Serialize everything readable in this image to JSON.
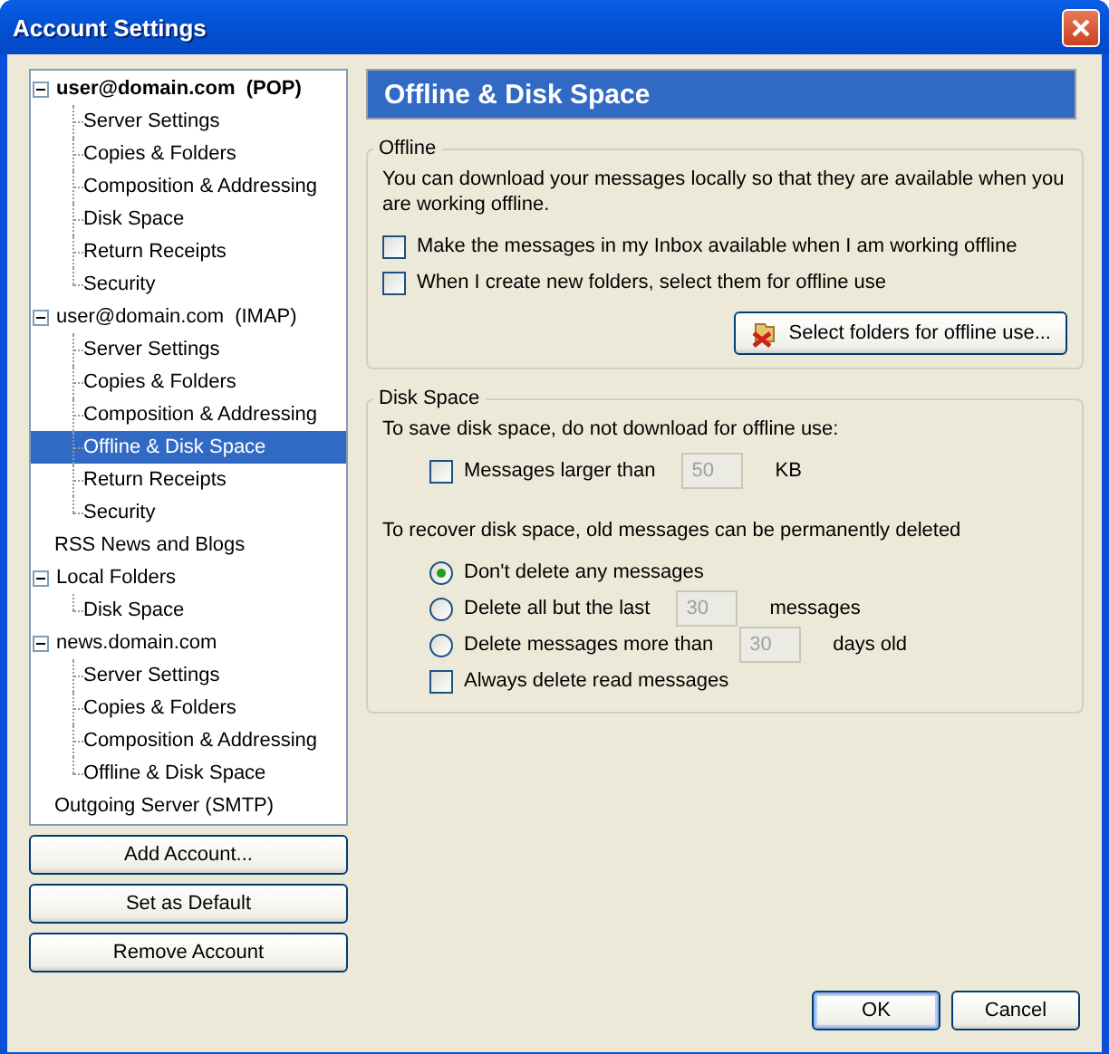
{
  "window": {
    "title": "Account Settings"
  },
  "tree": [
    {
      "label": "user@domain.com  (POP)",
      "is_default": true,
      "expanded": true,
      "selected": false,
      "children": [
        {
          "label": "Server Settings",
          "selected": false
        },
        {
          "label": "Copies & Folders",
          "selected": false
        },
        {
          "label": "Composition & Addressing",
          "selected": false
        },
        {
          "label": "Disk Space",
          "selected": false
        },
        {
          "label": "Return Receipts",
          "selected": false
        },
        {
          "label": "Security",
          "selected": false
        }
      ]
    },
    {
      "label": "user@domain.com  (IMAP)",
      "is_default": false,
      "expanded": true,
      "selected": false,
      "children": [
        {
          "label": "Server Settings",
          "selected": false
        },
        {
          "label": "Copies & Folders",
          "selected": false
        },
        {
          "label": "Composition & Addressing",
          "selected": false
        },
        {
          "label": "Offline & Disk Space",
          "selected": true
        },
        {
          "label": "Return Receipts",
          "selected": false
        },
        {
          "label": "Security",
          "selected": false
        }
      ]
    },
    {
      "label": "RSS News and Blogs",
      "is_default": false,
      "selected": false
    },
    {
      "label": "Local Folders",
      "is_default": false,
      "expanded": true,
      "selected": false,
      "children": [
        {
          "label": "Disk Space",
          "selected": false
        }
      ]
    },
    {
      "label": "news.domain.com",
      "is_default": false,
      "expanded": true,
      "selected": false,
      "children": [
        {
          "label": "Server Settings",
          "selected": false
        },
        {
          "label": "Copies & Folders",
          "selected": false
        },
        {
          "label": "Composition & Addressing",
          "selected": false
        },
        {
          "label": "Offline & Disk Space",
          "selected": false
        }
      ]
    },
    {
      "label": "Outgoing Server (SMTP)",
      "is_default": false,
      "selected": false
    }
  ],
  "account_buttons": [
    "Add Account...",
    "Set as Default",
    "Remove Account"
  ],
  "panel_header": "Offline & Disk Space",
  "offline": {
    "legend": "Offline",
    "description": "You can download your messages locally so that they are available when you are working offline.",
    "checkboxes": [
      {
        "label": "Make the messages in my Inbox available when I am working offline",
        "checked": false
      },
      {
        "label": "When I create new folders, select them for offline use",
        "checked": false
      }
    ],
    "button": "Select folders for offline use..."
  },
  "disk_space": {
    "legend": "Disk Space",
    "save_note": "To save disk space, do not download for offline use:",
    "size_limit": {
      "label": "Messages larger than",
      "checked": false,
      "value": "50",
      "disabled": true,
      "unit": "KB"
    },
    "recover_note": "To recover disk space, old messages can be permanently deleted",
    "options": [
      {
        "kind": "radio",
        "label": "Don't delete any messages",
        "selected": true
      },
      {
        "kind": "radio",
        "label": "Delete all but the last",
        "selected": false,
        "value": "30",
        "disabled": true,
        "unit": "messages"
      },
      {
        "kind": "radio",
        "label": "Delete messages more than",
        "selected": false,
        "value": "30",
        "disabled": true,
        "unit": "days old"
      },
      {
        "kind": "checkbox",
        "label": "Always delete read messages",
        "checked": false
      }
    ]
  },
  "footer_buttons": [
    {
      "label": "OK",
      "default": true
    },
    {
      "label": "Cancel",
      "default": false
    }
  ]
}
